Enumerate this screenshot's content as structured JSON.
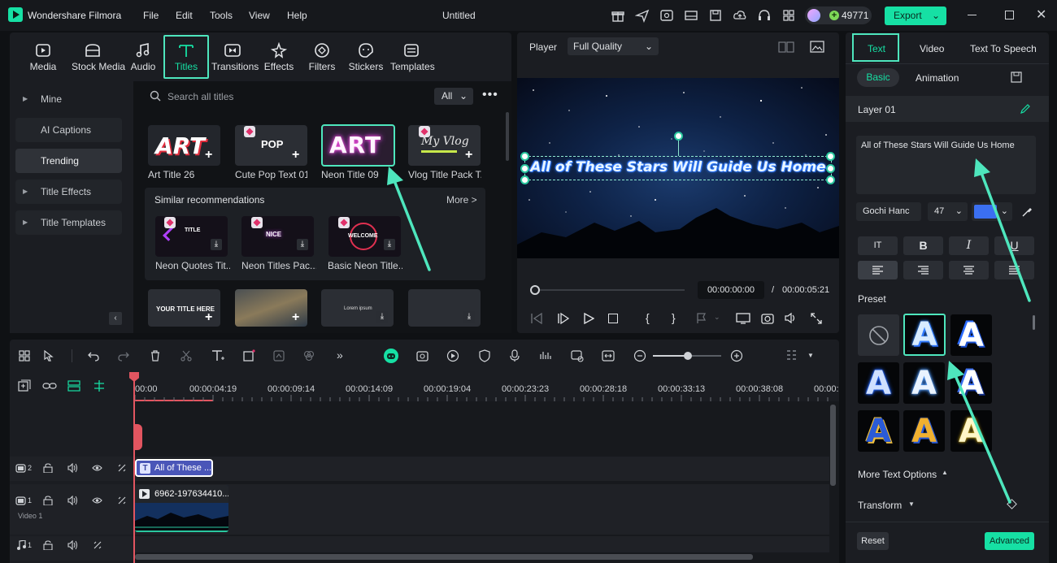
{
  "app": {
    "name": "Wondershare Filmora",
    "menu": [
      "File",
      "Edit",
      "Tools",
      "View",
      "Help"
    ],
    "document_title": "Untitled",
    "credits": "49771",
    "export_label": "Export"
  },
  "toolbar": {
    "tabs": [
      {
        "label": "Media",
        "icon": "media-icon"
      },
      {
        "label": "Stock Media",
        "icon": "stock-media-icon"
      },
      {
        "label": "Audio",
        "icon": "audio-icon"
      },
      {
        "label": "Titles",
        "icon": "titles-icon",
        "active": true
      },
      {
        "label": "Transitions",
        "icon": "transitions-icon"
      },
      {
        "label": "Effects",
        "icon": "effects-icon"
      },
      {
        "label": "Filters",
        "icon": "filters-icon"
      },
      {
        "label": "Stickers",
        "icon": "stickers-icon"
      },
      {
        "label": "Templates",
        "icon": "templates-icon"
      }
    ]
  },
  "sidebar": {
    "items": [
      {
        "label": "Mine",
        "expandable": true
      },
      {
        "label": "AI Captions",
        "expandable": false
      },
      {
        "label": "Trending",
        "expandable": false,
        "selected": true
      },
      {
        "label": "Title Effects",
        "expandable": true
      },
      {
        "label": "Title Templates",
        "expandable": true
      }
    ]
  },
  "library": {
    "search_placeholder": "Search all titles",
    "filter_value": "All",
    "titles": [
      {
        "name": "Art Title 26",
        "thumb_text": "ART"
      },
      {
        "name": "Cute Pop Text 01",
        "thumb_text": "POP"
      },
      {
        "name": "Neon Title 09",
        "thumb_text": "ART"
      },
      {
        "name": "Vlog Title Pack T...",
        "thumb_text": "My Vlog"
      }
    ],
    "similar_header": "Similar recommendations",
    "more_label": "More >",
    "similar": [
      {
        "name": "Neon Quotes Tit...",
        "thumb_text": "TITLE"
      },
      {
        "name": "Neon Titles Pac...",
        "thumb_text": "NICE"
      },
      {
        "name": "Basic Neon Title...",
        "thumb_text": "WELCOME"
      }
    ],
    "bottom_row": [
      {
        "thumb_text": "YOUR TITLE HERE"
      },
      {
        "thumb_text": ""
      },
      {
        "thumb_text": "Lorem ipsum"
      },
      {
        "thumb_text": ""
      }
    ]
  },
  "player": {
    "label": "Player",
    "quality": "Full Quality",
    "overlay_text": "All of These Stars Will Guide Us Home",
    "current_time": "00:00:00:00",
    "separator": "/",
    "total_time": "00:00:05:21",
    "progress": 0.0
  },
  "properties": {
    "tabs": [
      "Text",
      "Video",
      "Text To Speech"
    ],
    "subtabs": [
      "Basic",
      "Animation"
    ],
    "layer": "Layer 01",
    "text_value": "All of These Stars Will Guide Us Home",
    "font": "Gochi Hanc",
    "font_size": "47",
    "color": "#3b6ff0",
    "format_buttons": [
      "IT",
      "B",
      "I",
      "U"
    ],
    "preset_label": "Preset",
    "more_options": "More Text Options",
    "transform": "Transform",
    "reset": "Reset",
    "advanced": "Advanced"
  },
  "timeline": {
    "ruler": [
      "00:00",
      "00:00:04:19",
      "00:00:09:14",
      "00:00:14:09",
      "00:00:19:04",
      "00:00:23:23",
      "00:00:28:18",
      "00:00:33:13",
      "00:00:38:08",
      "00:00:"
    ],
    "tracks": [
      {
        "number": "2",
        "clip": "All of These ..."
      },
      {
        "number": "1",
        "label": "Video 1",
        "clip": "6962-197634410..."
      },
      {
        "number": "1"
      }
    ]
  },
  "colors": {
    "accent": "#16e0a4",
    "background": "#0f1114",
    "panel": "#1b1d22",
    "annotation": "#4ee6bd"
  }
}
